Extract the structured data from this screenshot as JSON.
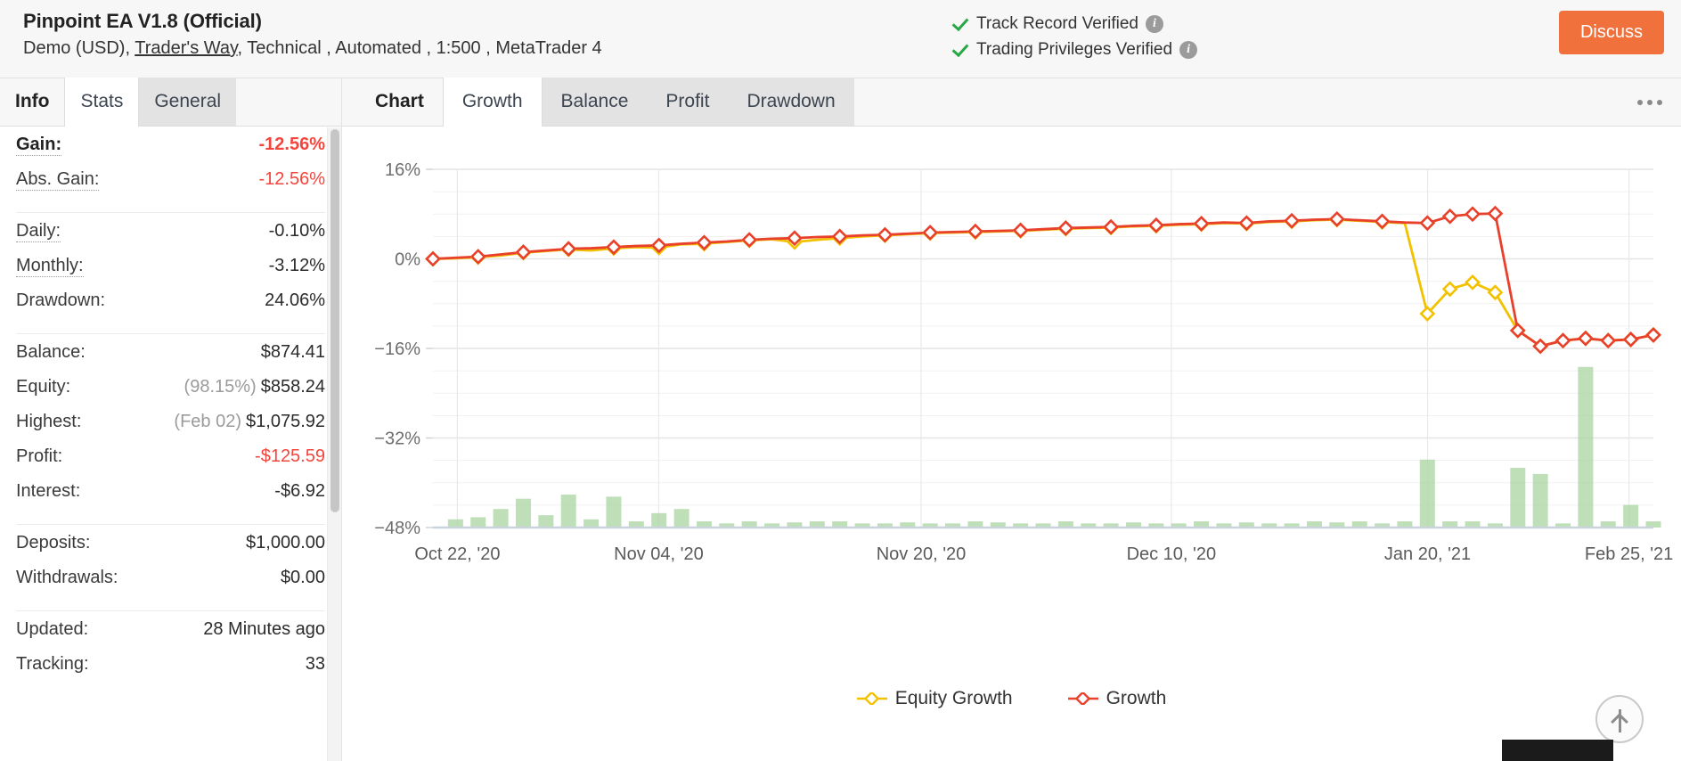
{
  "header": {
    "title": "Pinpoint EA V1.8 (Official)",
    "subtitle_pre": "Demo (USD),",
    "broker_link": "Trader's Way",
    "subtitle_post": ", Technical , Automated , 1:500 , MetaTrader 4",
    "verified": [
      {
        "label": "Track Record Verified",
        "icon": "check-icon",
        "info": "i"
      },
      {
        "label": "Trading Privileges Verified",
        "icon": "check-icon",
        "info": "i"
      }
    ],
    "discuss_label": "Discuss",
    "accent_color": "#f0713c"
  },
  "sidebar": {
    "tabs": [
      {
        "label": "Info",
        "state": "plain"
      },
      {
        "label": "Stats",
        "state": "active"
      },
      {
        "label": "General",
        "state": "inactive"
      }
    ],
    "groups": [
      {
        "rows": [
          {
            "label": "Gain:",
            "value": "-12.56%",
            "style": "neg-bold",
            "label_style": "bold dotted"
          },
          {
            "label": "Abs. Gain:",
            "value": "-12.56%",
            "style": "neg",
            "label_style": "dotted"
          }
        ]
      },
      {
        "rows": [
          {
            "label": "Daily:",
            "value": "-0.10%",
            "style": "",
            "label_style": "dotted"
          },
          {
            "label": "Monthly:",
            "value": "-3.12%",
            "style": "",
            "label_style": "dotted"
          },
          {
            "label": "Drawdown:",
            "value": "24.06%",
            "style": "",
            "label_style": ""
          }
        ]
      },
      {
        "rows": [
          {
            "label": "Balance:",
            "value": "$874.41",
            "style": "",
            "label_style": ""
          },
          {
            "label": "Equity:",
            "prefix": "(98.15%)",
            "value": "$858.24",
            "style": "",
            "label_style": ""
          },
          {
            "label": "Highest:",
            "prefix": "(Feb 02)",
            "value": "$1,075.92",
            "style": "",
            "label_style": ""
          },
          {
            "label": "Profit:",
            "value": "-$125.59",
            "style": "neg",
            "label_style": ""
          },
          {
            "label": "Interest:",
            "value": "-$6.92",
            "style": "",
            "label_style": ""
          }
        ]
      },
      {
        "rows": [
          {
            "label": "Deposits:",
            "value": "$1,000.00",
            "style": "",
            "label_style": ""
          },
          {
            "label": "Withdrawals:",
            "value": "$0.00",
            "style": "",
            "label_style": ""
          }
        ]
      },
      {
        "rows": [
          {
            "label": "Updated:",
            "value": "28 Minutes ago",
            "style": "",
            "label_style": ""
          },
          {
            "label": "Tracking:",
            "value": "33",
            "style": "",
            "label_style": ""
          }
        ]
      }
    ]
  },
  "chart_panel": {
    "tabs": [
      {
        "label": "Chart",
        "state": "plain"
      },
      {
        "label": "Growth",
        "state": "active"
      },
      {
        "label": "Balance",
        "state": "inactive"
      },
      {
        "label": "Profit",
        "state": "inactive"
      },
      {
        "label": "Drawdown",
        "state": "inactive"
      }
    ],
    "menu_icon": "ellipsis-icon",
    "scroll_top_icon": "arrow-up-icon"
  },
  "chart_data": {
    "type": "line",
    "title": "",
    "xlabel": "",
    "ylabel": "",
    "ylim": [
      -48,
      16
    ],
    "yticks": [
      16,
      0,
      -16,
      -32,
      -48
    ],
    "ytick_labels": [
      "16%",
      "0%",
      "−16%",
      "−32%",
      "−48%"
    ],
    "grid": true,
    "legend_position": "bottom",
    "xtick_labels": [
      "Oct 22, '20",
      "Nov 04, '20",
      "Nov 20, '20",
      "Dec 10, '20",
      "Jan 20, '21",
      "Feb 25, '21"
    ],
    "xtick_positions": [
      0.02,
      0.185,
      0.4,
      0.605,
      0.815,
      0.98
    ],
    "series": [
      {
        "name": "Equity Growth",
        "color": "#f2c200",
        "values": [
          0.0,
          0.1,
          0.3,
          0.6,
          1.1,
          1.4,
          1.7,
          1.5,
          1.9,
          2.1,
          2.0,
          2.6,
          2.7,
          3.0,
          3.3,
          3.5,
          3.0,
          3.4,
          3.7,
          4.0,
          4.2,
          4.4,
          4.6,
          4.7,
          4.8,
          4.9,
          5.0,
          5.2,
          5.4,
          5.5,
          5.6,
          5.8,
          5.9,
          6.1,
          6.2,
          6.4,
          6.3,
          6.6,
          6.7,
          6.9,
          7.0,
          6.8,
          6.6,
          6.4,
          -9.8,
          -5.4,
          -4.2,
          -6.0,
          -12.8,
          -15.6,
          -14.6,
          -14.2,
          -14.6,
          -14.4,
          -13.6
        ]
      },
      {
        "name": "Growth",
        "color": "#e8402a",
        "values": [
          0.0,
          0.2,
          0.4,
          0.8,
          1.2,
          1.5,
          1.8,
          1.9,
          2.1,
          2.3,
          2.4,
          2.7,
          2.9,
          3.1,
          3.4,
          3.6,
          3.7,
          3.9,
          4.0,
          4.2,
          4.3,
          4.5,
          4.7,
          4.8,
          4.9,
          5.0,
          5.1,
          5.3,
          5.5,
          5.6,
          5.7,
          5.9,
          6.0,
          6.2,
          6.3,
          6.5,
          6.4,
          6.7,
          6.8,
          7.0,
          7.1,
          6.9,
          6.7,
          6.5,
          6.4,
          7.6,
          8.0,
          8.1,
          -12.8,
          -15.6,
          -14.6,
          -14.2,
          -14.6,
          -14.4,
          -13.6
        ]
      }
    ],
    "volume_bars": {
      "name": "Volume",
      "color": "#a9d4a2",
      "baseline": -48,
      "values": [
        0,
        0.4,
        0.5,
        0.9,
        1.4,
        0.6,
        1.6,
        0.4,
        1.5,
        0.3,
        0.7,
        0.9,
        0.3,
        0.2,
        0.3,
        0.2,
        0.25,
        0.3,
        0.3,
        0.2,
        0.2,
        0.25,
        0.2,
        0.2,
        0.3,
        0.25,
        0.2,
        0.2,
        0.3,
        0.2,
        0.2,
        0.25,
        0.2,
        0.2,
        0.3,
        0.2,
        0.25,
        0.2,
        0.2,
        0.3,
        0.25,
        0.3,
        0.2,
        0.3,
        3.3,
        0.3,
        0.3,
        0.2,
        2.9,
        2.6,
        0.2,
        7.8,
        0.3,
        1.1,
        0.3
      ]
    }
  }
}
